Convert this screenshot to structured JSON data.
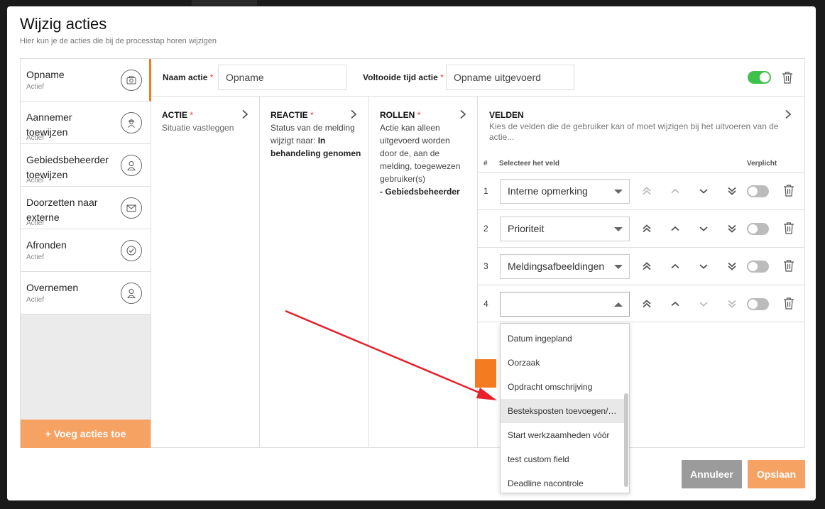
{
  "modal": {
    "title": "Wijzig acties",
    "subtitle": "Hier kun je de acties die bij de processtap horen wijzigen"
  },
  "sidebar": {
    "items": [
      {
        "name": "Opname",
        "status": "Actief",
        "icon": "camera-icon"
      },
      {
        "name": "Aannemer toewijzen",
        "status": "Actief",
        "icon": "worker-icon"
      },
      {
        "name": "Gebiedsbeheerder toewijzen",
        "status": "Actief",
        "icon": "user-icon"
      },
      {
        "name": "Doorzetten naar externe",
        "status": "Actief",
        "icon": "mail-icon"
      },
      {
        "name": "Afronden",
        "status": "Actief",
        "icon": "check-circle-icon"
      },
      {
        "name": "Overnemen",
        "status": "Actief",
        "icon": "user-icon"
      }
    ],
    "add_label": "+ Voeg acties toe"
  },
  "topbar": {
    "name_label": "Naam actie",
    "name_value": "Opname",
    "time_label": "Voltooide tijd actie",
    "time_value": "Opname uitgevoerd",
    "required_mark": "*"
  },
  "columns": {
    "actie": {
      "header": "ACTIE",
      "desc": "Situatie vastleggen"
    },
    "reactie": {
      "header": "REACTIE",
      "desc_1": "Status van de melding",
      "desc_2": "wijzigt naar:",
      "desc_bold_1": "In",
      "desc_bold_2": "behandeling genomen"
    },
    "rollen": {
      "header": "ROLLEN",
      "lines": [
        "Actie kan alleen",
        "uitgevoerd worden",
        "door de, aan de",
        "melding, toegewezen",
        "gebruiker(s)"
      ],
      "role": "- Gebiedsbeheerder"
    }
  },
  "velden": {
    "header": "VELDEN",
    "desc": "Kies de velden die de gebruiker kan of moet wijzigen bij het uitvoeren van de actie...",
    "col_num": "#",
    "col_select": "Selecteer het veld",
    "col_required": "Verplicht",
    "rows": [
      {
        "num": "1",
        "value": "Interne opmerking"
      },
      {
        "num": "2",
        "value": "Prioriteit"
      },
      {
        "num": "3",
        "value": "Meldingsafbeeldingen"
      },
      {
        "num": "4",
        "value": ""
      }
    ]
  },
  "dropdown": {
    "options": [
      "Datum ingepland",
      "Oorzaak",
      "Opdracht omschrijving",
      "Besteksposten toevoegen/…",
      "Start werkzaamheden vóór",
      "test custom field",
      "Deadline nacontrole"
    ],
    "highlighted": "Besteksposten toevoegen/…"
  },
  "footer": {
    "cancel_label": "Annuleer",
    "save_label": "Opslaan"
  },
  "colors": {
    "accent": "#f47b20",
    "accent_light": "#f5a263",
    "toggle_on": "#3ec24b",
    "annotation_arrow": "#e8202a"
  }
}
